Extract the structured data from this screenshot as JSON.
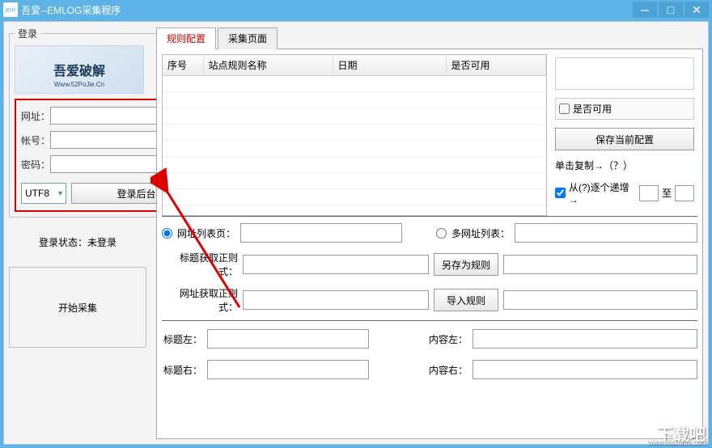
{
  "titlebar": {
    "icon_text": "em",
    "title": "吾爱--EMLOG采集程序"
  },
  "sidebar": {
    "login_legend": "登录",
    "logo_text1": "吾爱破解",
    "logo_text2": "Www.52PoJie.Cn",
    "url_label": "网址：",
    "url_value": "",
    "account_label": "帐号：",
    "account_value": "",
    "password_label": "密码：",
    "password_value": "",
    "encoding": "UTF8",
    "login_btn": "登录后台",
    "status_label": "登录状态：",
    "status_value": "未登录",
    "start_btn": "开始采集"
  },
  "tabs": {
    "tab1": "规则配置",
    "tab2": "采集页面"
  },
  "table": {
    "col1": "序号",
    "col2": "站点规则名称",
    "col3": "日期",
    "col4": "是否可用"
  },
  "right": {
    "enable_label": "是否可用",
    "save_btn": "保存当前配置",
    "copy_label": "单击复制→（？）",
    "inc_label": "从(?)逐个递增 →",
    "to_label": "至"
  },
  "middle": {
    "radio1": "网址列表页：",
    "input1": "",
    "radio2": "多网址列表：",
    "input2": "",
    "title_regex_label": "标题获取正则式：",
    "title_regex_value": "",
    "url_regex_label": "网址获取正则式：",
    "url_regex_value": "",
    "save_rule_btn": "另存为规则",
    "import_rule_btn": "导入规则"
  },
  "lower": {
    "title_left": "标题左：",
    "title_left_v": "",
    "content_left": "内容左：",
    "content_left_v": "",
    "title_right": "标题右：",
    "title_right_v": "",
    "content_right": "内容右：",
    "content_right_v": ""
  },
  "watermark": "下载吧",
  "source_url": "www.xiazaiba.com"
}
